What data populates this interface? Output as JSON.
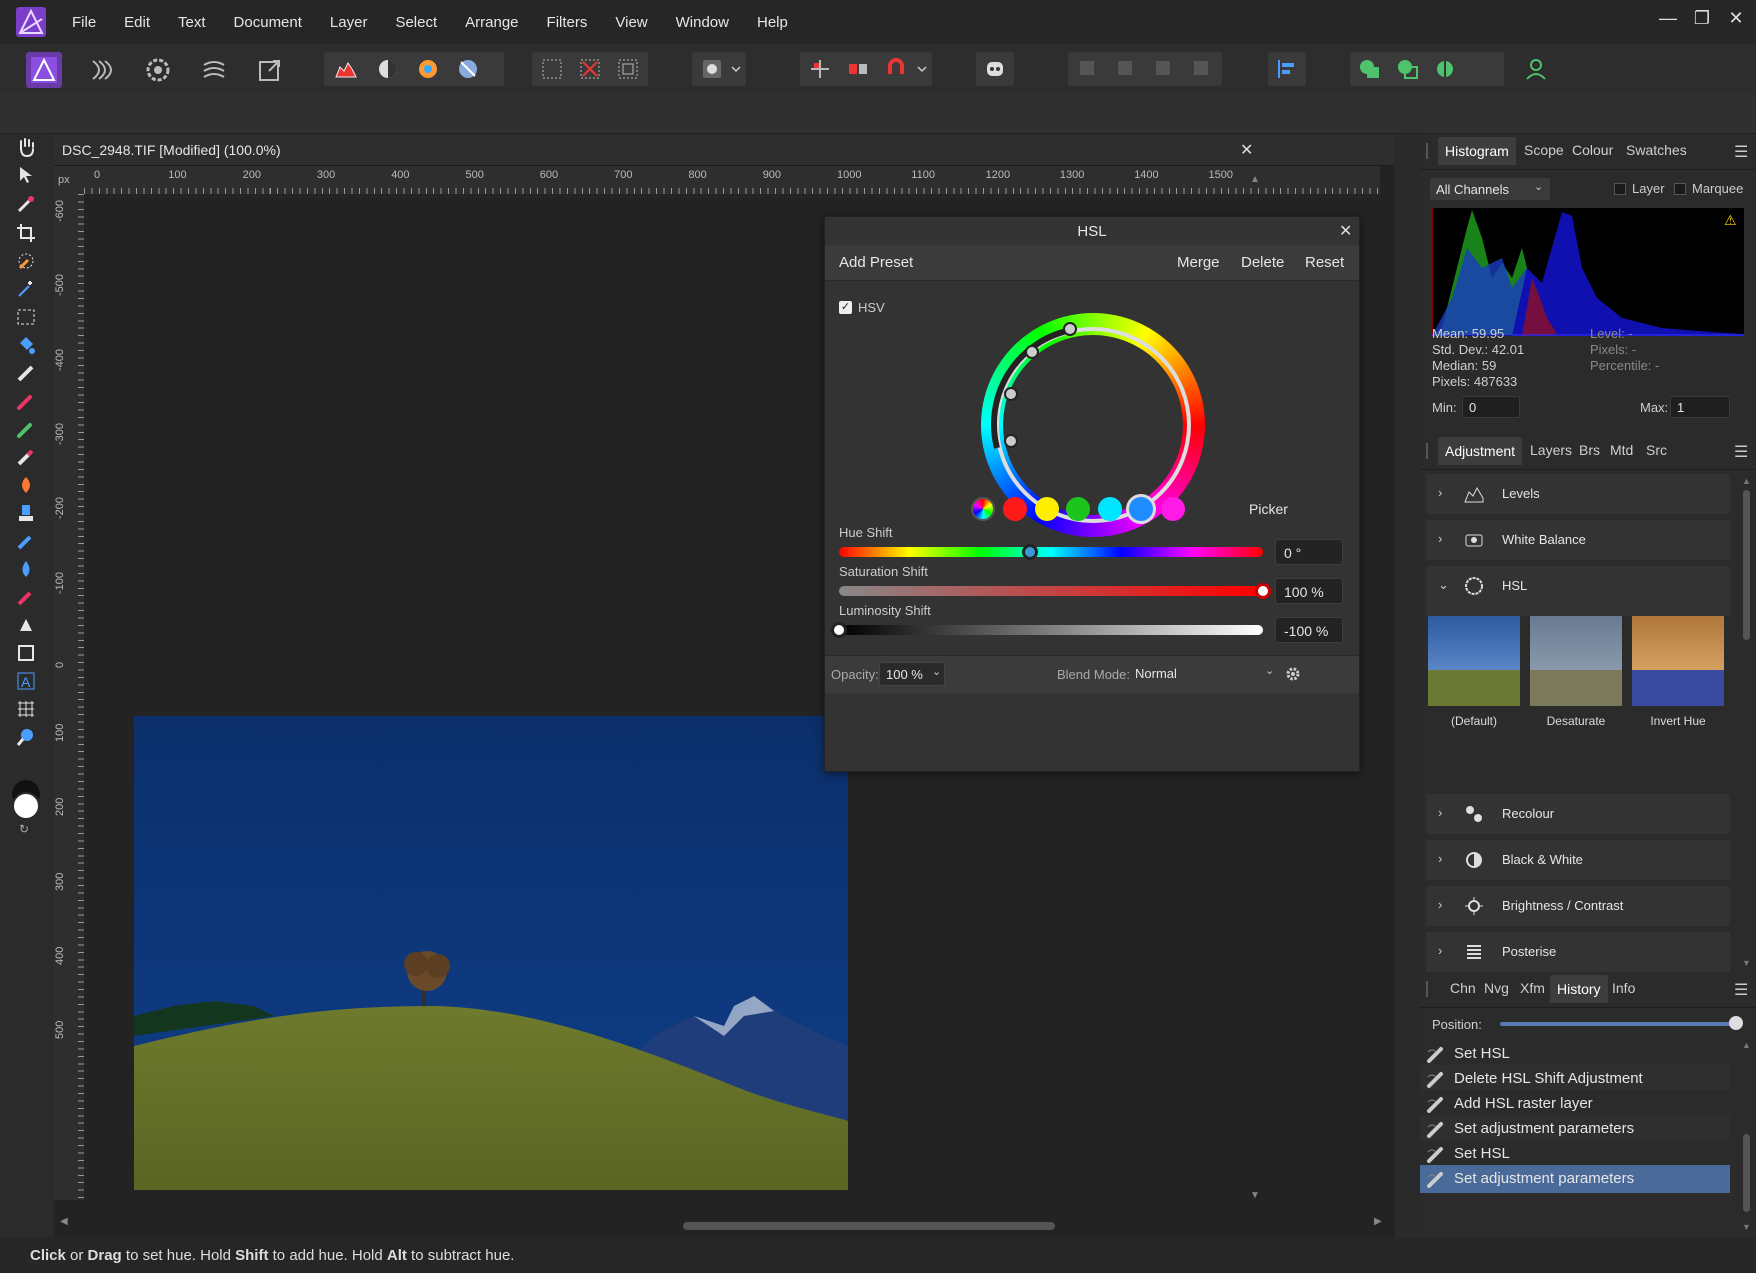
{
  "menu": {
    "items": [
      "File",
      "Edit",
      "Text",
      "Document",
      "Layer",
      "Select",
      "Arrange",
      "Filters",
      "View",
      "Window",
      "Help"
    ]
  },
  "window_controls": {
    "minimize": "—",
    "maximize": "❐",
    "close": "✕"
  },
  "document": {
    "title": "DSC_2948.TIF [Modified] (100.0%)",
    "close": "✕",
    "ruler_unit": "px",
    "ruler_h": [
      "0",
      "100",
      "200",
      "300",
      "400",
      "500",
      "600",
      "700",
      "800",
      "900",
      "1000",
      "1100",
      "1200",
      "1300",
      "1400",
      "1500"
    ],
    "ruler_v": [
      "-600",
      "-500",
      "-400",
      "-300",
      "-200",
      "-100",
      "0",
      "100",
      "200",
      "300",
      "400",
      "500"
    ]
  },
  "hsl_dialog": {
    "title": "HSL",
    "close": "✕",
    "add_preset": "Add Preset",
    "merge": "Merge",
    "delete": "Delete",
    "reset": "Reset",
    "hsv_label": "HSV",
    "hsv_checked": true,
    "picker": "Picker",
    "hue_label": "Hue Shift",
    "hue_value": "0 °",
    "hue_position": 0.45,
    "sat_label": "Saturation Shift",
    "sat_value": "100 %",
    "sat_position": 1.0,
    "lum_label": "Luminosity Shift",
    "lum_value": "-100 %",
    "lum_position": 0.0,
    "opacity_label": "Opacity:",
    "opacity_value": "100 %",
    "blend_label": "Blend Mode:",
    "blend_value": "Normal",
    "color_dots": [
      "#ff1a1a",
      "#ffee00",
      "#1ec41e",
      "#00e5ff",
      "#1f8cff",
      "#ff1ae5"
    ],
    "selected_dot": 4
  },
  "histogram_panel": {
    "tabs": [
      "Histogram",
      "Scope",
      "Colour",
      "Swatches"
    ],
    "active_tab": 0,
    "channel": "All Channels",
    "layer_label": "Layer",
    "marquee_label": "Marquee",
    "mean": "Mean: 59.95",
    "std_dev": "Std. Dev.: 42.01",
    "median": "Median: 59",
    "pixels": "Pixels: 487633",
    "level": "Level: -",
    "pixels_r": "Pixels: -",
    "percentile": "Percentile: -",
    "min_label": "Min:",
    "min_value": "0",
    "max_label": "Max:",
    "max_value": "1",
    "warning": "⚠"
  },
  "adjustment_panel": {
    "tabs": [
      "Adjustment",
      "Layers",
      "Brs",
      "Mtd",
      "Src"
    ],
    "active_tab": 0,
    "items": [
      "Levels",
      "White Balance",
      "HSL",
      "Recolour",
      "Black & White",
      "Brightness / Contrast",
      "Posterise"
    ],
    "presets": [
      "(Default)",
      "Desaturate",
      "Invert Hue"
    ]
  },
  "history_panel": {
    "tabs": [
      "Chn",
      "Nvg",
      "Xfm",
      "History",
      "Info"
    ],
    "active_tab": 3,
    "position_label": "Position:",
    "position_value": 1.0,
    "items": [
      "Set HSL",
      "Delete HSL Shift Adjustment",
      "Add HSL raster layer",
      "Set adjustment parameters",
      "Set HSL",
      "Set adjustment parameters"
    ],
    "selected": 5
  },
  "status_bar": {
    "click": "Click",
    "or": " or ",
    "drag": "Drag",
    "t1": " to set hue. Hold ",
    "shift": "Shift",
    "t2": " to add hue. Hold ",
    "alt": "Alt",
    "t3": " to subtract hue."
  },
  "colors": {
    "accent": "#3d5f8f",
    "selection": "#4a6b99",
    "bg": "#2a2a2a"
  }
}
